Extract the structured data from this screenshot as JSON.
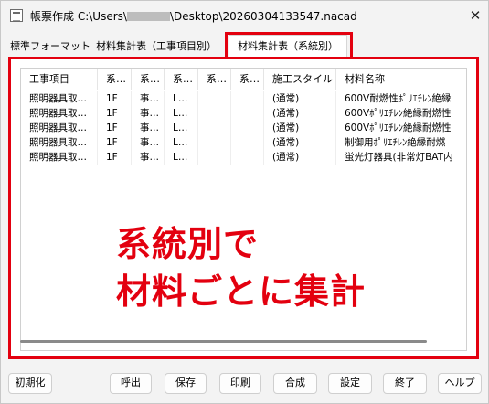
{
  "window": {
    "title_prefix": "帳票作成 C:\\Users\\",
    "title_suffix": "\\Desktop\\20260304133547.nacad",
    "close_glyph": "✕"
  },
  "tabs": [
    {
      "label": "標準フォーマット"
    },
    {
      "label": "材料集計表（工事項目別）"
    },
    {
      "label": "材料集計表（系統別）",
      "active": true
    }
  ],
  "list": {
    "columns": [
      "工事項目",
      "系…",
      "系…",
      "系…",
      "系…",
      "系…",
      "施工スタイル",
      "材料名称"
    ],
    "rows": [
      [
        "照明器具取…",
        "1F",
        "事…",
        "L…",
        "",
        "",
        "(通常)",
        "600V耐燃性ﾎﾟﾘｴﾁﾚﾝ絶縁"
      ],
      [
        "照明器具取…",
        "1F",
        "事…",
        "L…",
        "",
        "",
        "(通常)",
        "600Vﾎﾟﾘｴﾁﾚﾝ絶縁耐燃性"
      ],
      [
        "照明器具取…",
        "1F",
        "事…",
        "L…",
        "",
        "",
        "(通常)",
        "600Vﾎﾟﾘｴﾁﾚﾝ絶縁耐燃性"
      ],
      [
        "照明器具取…",
        "1F",
        "事…",
        "L…",
        "",
        "",
        "(通常)",
        "制御用ﾎﾟﾘｴﾁﾚﾝ絶縁耐燃"
      ],
      [
        "照明器具取…",
        "1F",
        "事…",
        "L…",
        "",
        "",
        "(通常)",
        "蛍光灯器具(非常灯BAT内"
      ]
    ]
  },
  "annotation": {
    "line1": "系統別で",
    "line2": "材料ごとに集計",
    "color": "#e3000f"
  },
  "buttons": {
    "reset": "初期化",
    "load": "呼出",
    "save": "保存",
    "print": "印刷",
    "merge": "合成",
    "settings": "設定",
    "finish": "終了",
    "help": "ヘルプ"
  }
}
